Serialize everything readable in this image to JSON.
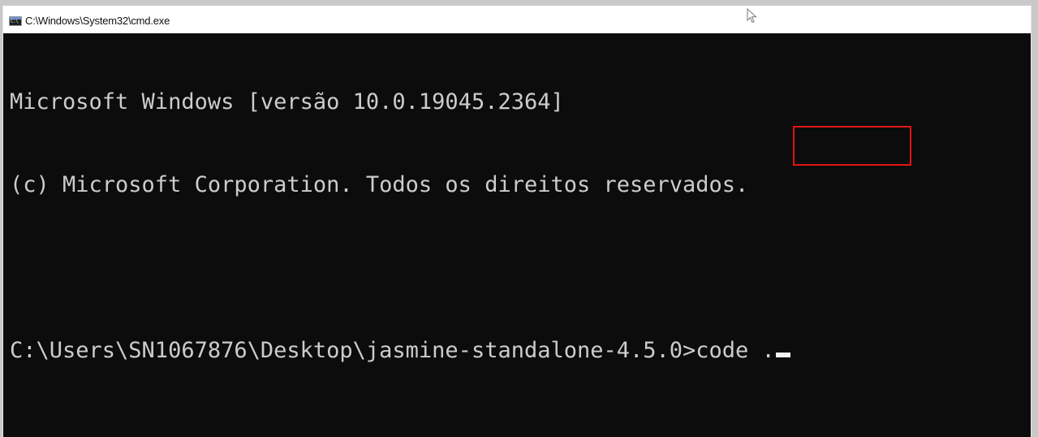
{
  "window": {
    "title": "C:\\Windows\\System32\\cmd.exe",
    "icon_name": "cmd-window-icon",
    "icon_text": "C:\\",
    "background_color": "#0c0c0c",
    "text_color": "#cccccc"
  },
  "console": {
    "lines": [
      "Microsoft Windows [versão 10.0.19045.2364]",
      "(c) Microsoft Corporation. Todos os direitos reservados.",
      ""
    ],
    "prompt": "C:\\Users\\SN1067876\\Desktop\\jasmine-standalone-4.5.0>",
    "command": "code ."
  },
  "annotation": {
    "highlight_color": "#e01515"
  }
}
